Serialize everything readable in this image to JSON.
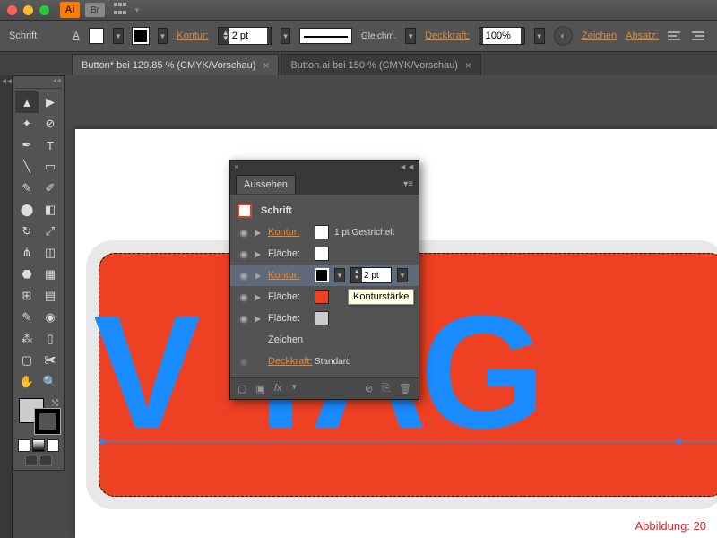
{
  "titlebar": {
    "ai": "Ai",
    "br": "Br"
  },
  "controlbar": {
    "schrift": "Schrift",
    "kontur": "Kontur:",
    "kontur_val": "2 pt",
    "gleichm": "Gleichm.",
    "deckkraft": "Deckkraft:",
    "deckkraft_val": "100%",
    "zeichen": "Zeichen",
    "absatz": "Absatz:"
  },
  "tabs": [
    {
      "label": "Button* bei 129,85 % (CMYK/Vorschau)"
    },
    {
      "label": "Button.ai bei 150 % (CMYK/Vorschau)"
    }
  ],
  "canvas": {
    "text": "V    TAG",
    "caption": "Abbildung: 20"
  },
  "panel": {
    "title": "Aussehen",
    "header": "Schrift",
    "rows": [
      {
        "eye": true,
        "label": "Kontur:",
        "orange": true,
        "color": "#ffffff",
        "val": "1 pt Gestrichelt"
      },
      {
        "eye": true,
        "label": "Fläche:",
        "orange": false,
        "color": "#ffffff",
        "val": ""
      },
      {
        "eye": true,
        "label": "Kontur:",
        "orange": true,
        "color": "#000000",
        "val": "2 pt",
        "selected": true,
        "stepper": true
      },
      {
        "eye": true,
        "label": "Fläche:",
        "orange": false,
        "color": "#ee4023",
        "val": ""
      },
      {
        "eye": true,
        "label": "Fläche:",
        "orange": false,
        "color": "#cccccc",
        "val": ""
      }
    ],
    "zeichen": "Zeichen",
    "deckkraft": "Deckkraft:",
    "deckkraft_val": "Standard",
    "fx": "fx"
  },
  "tooltip": "Konturstärke"
}
